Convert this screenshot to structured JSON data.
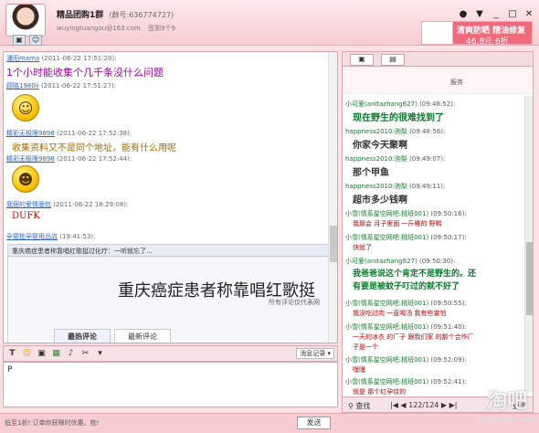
{
  "window": {
    "group_name": "精品团购1群",
    "group_number": "(群号:636774727)",
    "email": "wuyingtuangou@163.com",
    "signature": "签到9个9"
  },
  "ad": {
    "line1": "清爽防晒 精油修复",
    "line2": "46.8元   6折"
  },
  "chat": {
    "messages": [
      {
        "nick": "潘阳mama",
        "time": "(2011-06-22 17:51:20):",
        "text": "1个小时能收集个几千条没什么问题",
        "color": "#a800a8"
      },
      {
        "nick": "顾晓1980ii",
        "time": "(2011-06-22 17:51:27):",
        "text": ""
      },
      {
        "nick": "精彩无极限9898",
        "time": "(2011-06-22 17:52:38):",
        "text": "收集资料又不是同个地址，能有什么用呢",
        "color": "#a36b00"
      },
      {
        "nick": "精彩无极限9898",
        "time": "(2011-06-22 17:52:44):",
        "text": ""
      },
      {
        "nick": "我宿的爱情面包",
        "time": "(2011-06-22 18:29:08):",
        "text": "DUFK",
        "color": "#d40000"
      },
      {
        "nick": "孕婴批孕婴用品店",
        "time": "(19:41:53):",
        "text": ""
      }
    ],
    "preview": {
      "header": "重庆癌症患者称靠唱红歌挺过化疗：一听就忘了...",
      "headline": "重庆癌症患者称靠唱红歌挺",
      "subline": "所有评论仅代表网",
      "tab_hot": "最热评论",
      "tab_new": "最新评论"
    }
  },
  "input": {
    "history_label": "消息记录",
    "text": "P"
  },
  "bottom": {
    "ticker": "低至1折!  订单你获限时优惠，抢!",
    "send_label": "发送"
  },
  "right": {
    "top_label": "服务",
    "messages": [
      {
        "nick": "小可爱(anitazhang627)",
        "time": "(09:48:52):",
        "text": "现在野生的很难找到了",
        "color": "#0a7a2a",
        "big": true
      },
      {
        "nick": "happness2010:驹梨",
        "time": "(09:48:56):",
        "text": "你家今天聚啊",
        "color": "#000",
        "big": true
      },
      {
        "nick": "happness2010:驹梨",
        "time": "(09:49:07):",
        "text": "那个甲鱼",
        "color": "#000",
        "big": true
      },
      {
        "nick": "happness2010:驹梨",
        "time": "(09:49:11):",
        "text": "超市多少钱啊",
        "color": "#000",
        "big": true
      },
      {
        "nick": "小雪(情系星空网吧:桃班001)",
        "time": "(09:50:16):",
        "text": "我那会  月子里面   一斤稚的  野鸭",
        "color": "#c00000",
        "big": false
      },
      {
        "nick": "小雪(情系星空网吧:桃班001)",
        "time": "(09:50:17):",
        "text": "快就了",
        "color": "#c00000",
        "big": false
      },
      {
        "nick": "小可爱(anitazhang627)",
        "time": "(09:50:30):",
        "text": "我爸爸说这个肯定不是野生的。还",
        "text2": "有要是被蚊子叮过的就不好了",
        "color": "#0a7a2a",
        "big": true
      },
      {
        "nick": "小雪(情系星空网吧:桃班001)",
        "time": "(09:50:55):",
        "text": "我没吃过肉  一直喝汤  我有些害怕",
        "color": "#c00000",
        "big": false
      },
      {
        "nick": "小雪(情系星空网吧:桃班001)",
        "time": "(09:51:40):",
        "text": "一天的冰衣  的厂子   跟我们家  的那个合作厂",
        "text2": "子是一个",
        "color": "#c00000",
        "big": false
      },
      {
        "nick": "小雪(情系星空网吧:桃班001)",
        "time": "(09:52:09):",
        "text": "嘿嘿",
        "color": "#c00000",
        "big": false
      },
      {
        "nick": "小雪(情系星空网吧:桃班001)",
        "time": "(09:52:41):",
        "text": "就是  那个红孕纹的",
        "color": "#c00000",
        "big": false
      }
    ],
    "find_label": "查找",
    "page": "122/124",
    "more_label": "更多"
  },
  "watermark": {
    "text": "淘吧",
    "sub": "8.taobao.com"
  }
}
